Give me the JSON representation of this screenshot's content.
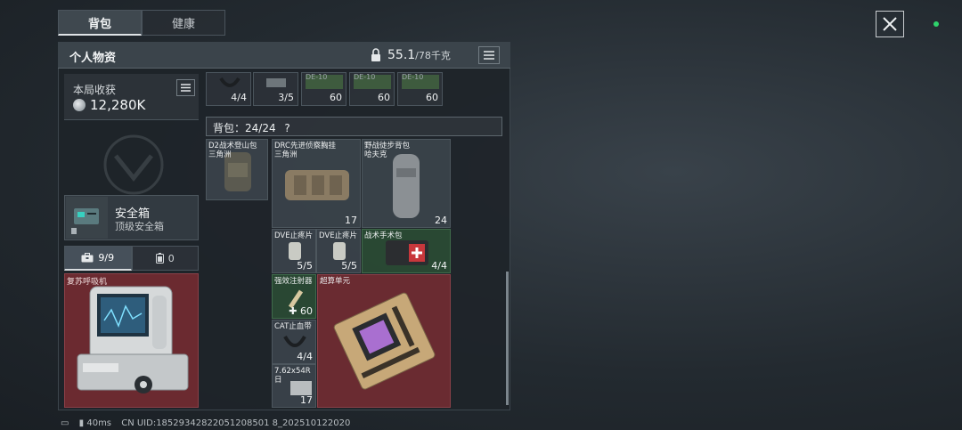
{
  "tabs": [
    {
      "label": "背包",
      "active": true
    },
    {
      "label": "健康",
      "active": false
    }
  ],
  "panel": {
    "title": "个人物资",
    "weight_value": "55.1",
    "weight_cap": "/78千克"
  },
  "harvest": {
    "label": "本局收获",
    "value": "12,280K"
  },
  "safebox": {
    "title": "安全箱",
    "subtitle": "顶级安全箱",
    "tabs": [
      {
        "label": "9/9",
        "icon": "briefcase-icon",
        "active": true
      },
      {
        "label": "0",
        "icon": "battery-icon",
        "active": false
      }
    ],
    "item_label": "复苏呼吸机"
  },
  "top_row": [
    {
      "count": "4/4",
      "tag": ""
    },
    {
      "count": "3/5",
      "tag": ""
    },
    {
      "count": "60",
      "tag": "DE-10"
    },
    {
      "count": "60",
      "tag": "DE-10"
    },
    {
      "count": "60",
      "tag": "DE-10"
    }
  ],
  "backpack": {
    "label": "背包：24/24",
    "help": "?"
  },
  "items": {
    "d2_bag": {
      "name": "D2战术登山包",
      "sub": "三角洲",
      "count": ""
    },
    "drc_vest": {
      "name": "DRC先进侦察胸挂",
      "sub": "三角洲",
      "count": "17"
    },
    "field_bag": {
      "name": "野战徒步背包",
      "sub": "哈夫克",
      "count": "24"
    },
    "dve1": {
      "name": "DVE止疼片",
      "count": "5/5"
    },
    "dve2": {
      "name": "DVE止疼片",
      "count": "5/5"
    },
    "surgery_kit": {
      "name": "战术手术包",
      "count": "4/4"
    },
    "injector": {
      "name": "强效注射器",
      "count": "60"
    },
    "supercompute": {
      "name": "超算单元",
      "count": ""
    },
    "cat_tourniquet": {
      "name": "CAT止血带",
      "count": "4/4"
    },
    "ammo": {
      "name": "7.62x54R",
      "sub": "日",
      "count": "17"
    }
  },
  "status": {
    "ping": "40ms",
    "uid": "CN UID:18529342822051208501 8_202510122020"
  },
  "colors": {
    "accent_green": "#2fd36c",
    "item_red": "#6a2b31",
    "item_green": "#2a4a34"
  }
}
